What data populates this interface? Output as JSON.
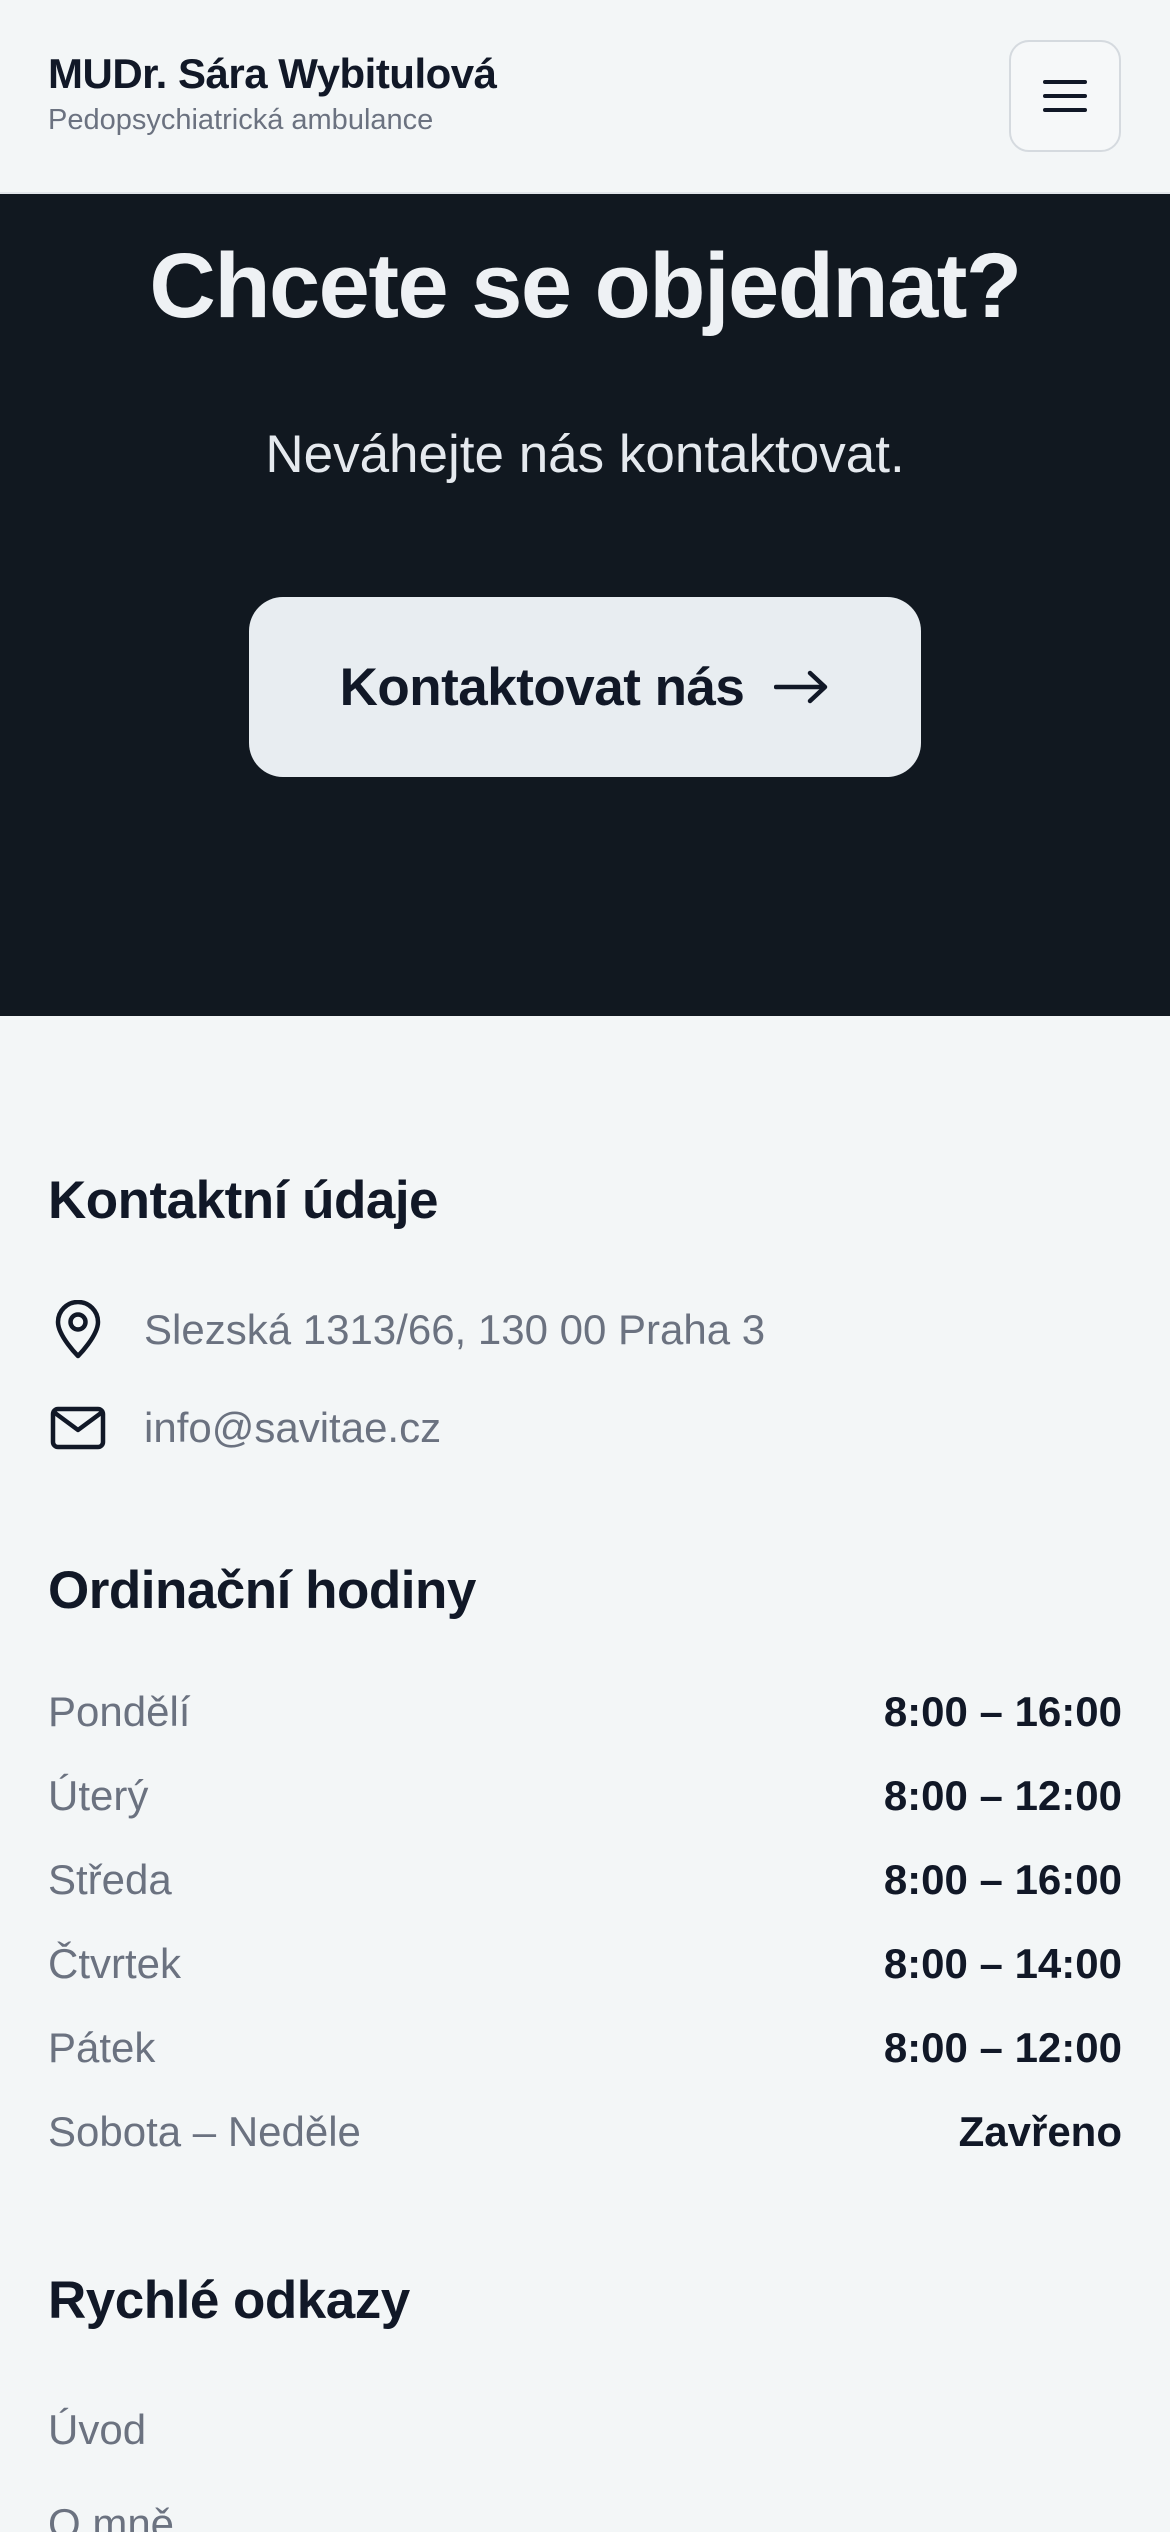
{
  "header": {
    "title": "MUDr. Sára Wybitulová",
    "subtitle": "Pedopsychiatrická ambulance",
    "menu_icon": "hamburger-icon"
  },
  "hero": {
    "title": "Chcete se objednat?",
    "subtitle": "Neváhejte nás kontaktovat.",
    "cta_label": "Kontaktovat nás",
    "cta_icon": "arrow-right-icon"
  },
  "contact": {
    "title": "Kontaktní údaje",
    "address": "Slezská 1313/66, 130 00 Praha 3",
    "address_icon": "map-pin-icon",
    "email": "info@savitae.cz",
    "email_icon": "mail-icon"
  },
  "hours": {
    "title": "Ordinační hodiny",
    "rows": [
      {
        "day": "Pondělí",
        "time": "8:00 – 16:00"
      },
      {
        "day": "Úterý",
        "time": "8:00 – 12:00"
      },
      {
        "day": "Středa",
        "time": "8:00 – 16:00"
      },
      {
        "day": "Čtvrtek",
        "time": "8:00 – 14:00"
      },
      {
        "day": "Pátek",
        "time": "8:00 – 12:00"
      },
      {
        "day": "Sobota – Neděle",
        "time": "Zavřeno"
      }
    ]
  },
  "links": {
    "title": "Rychlé odkazy",
    "items": [
      "Úvod",
      "O mně"
    ]
  },
  "colors": {
    "page_bg": "#f3f6f7",
    "hero_bg": "#111820",
    "cta_bg": "#e8edf1",
    "text_primary": "#111827",
    "text_muted": "#6b7280"
  }
}
